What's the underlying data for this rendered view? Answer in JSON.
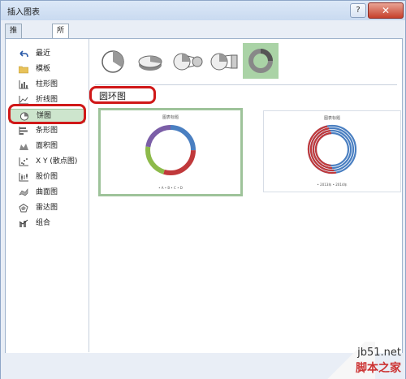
{
  "window": {
    "title": "插入图表"
  },
  "titlebar": {
    "help_label": "?",
    "close_label": "✕"
  },
  "tabs": [
    {
      "label": "推荐的图表"
    },
    {
      "label": "所有图表"
    }
  ],
  "sidebar": {
    "items": [
      {
        "label": "最近",
        "icon": "undo-icon"
      },
      {
        "label": "模板",
        "icon": "folder-icon"
      },
      {
        "label": "柱形图",
        "icon": "column-chart-icon"
      },
      {
        "label": "折线图",
        "icon": "line-chart-icon"
      },
      {
        "label": "饼图",
        "icon": "pie-chart-icon",
        "selected": true
      },
      {
        "label": "条形图",
        "icon": "bar-chart-icon"
      },
      {
        "label": "面积图",
        "icon": "area-chart-icon"
      },
      {
        "label": "X Y (散点图)",
        "icon": "scatter-chart-icon"
      },
      {
        "label": "股价图",
        "icon": "stock-chart-icon"
      },
      {
        "label": "曲面图",
        "icon": "surface-chart-icon"
      },
      {
        "label": "雷达图",
        "icon": "radar-chart-icon"
      },
      {
        "label": "组合",
        "icon": "combo-chart-icon"
      }
    ]
  },
  "subtypes": [
    {
      "icon": "pie-icon"
    },
    {
      "icon": "3d-pie-icon"
    },
    {
      "icon": "pie-of-pie-icon"
    },
    {
      "icon": "bar-of-pie-icon"
    },
    {
      "icon": "doughnut-icon",
      "selected": true
    }
  ],
  "main": {
    "heading": "圆环图",
    "previews": [
      {
        "title": "图表标题",
        "legend": "• A  • B  • C  • D",
        "colors": [
          "#4a7fc1",
          "#c0393b",
          "#8dba4a",
          "#7b5ea7"
        ]
      },
      {
        "title": "图表标题",
        "legend": "• 2013年  • 2014年",
        "colors": [
          "#4a7fc1",
          "#c0393b"
        ]
      }
    ]
  },
  "watermark": {
    "site": "jb51.net",
    "name": "脚本之家"
  }
}
